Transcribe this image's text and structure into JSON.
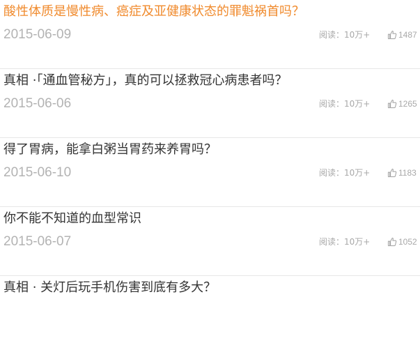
{
  "articles": [
    {
      "title": "酸性体质是慢性病、癌症及亚健康状态的罪魁祸首吗？",
      "date": "2015-06-09",
      "reads": "阅读：10万+",
      "likes": "1487",
      "title_color": "#f08a2c"
    },
    {
      "title": "真相 ·「通血管秘方」，真的可以拯救冠心病患者吗？",
      "date": "2015-06-06",
      "reads": "阅读：10万+",
      "likes": "1265"
    },
    {
      "title": "得了胃病，能拿白粥当胃药来养胃吗？",
      "date": "2015-06-10",
      "reads": "阅读：10万+",
      "likes": "1183"
    },
    {
      "title": "你不能不知道的血型常识",
      "date": "2015-06-07",
      "reads": "阅读：10万+",
      "likes": "1052"
    },
    {
      "title": "真相 · 关灯后玩手机伤害到底有多大？"
    }
  ],
  "icons": {
    "like": "thumbs-up-icon"
  }
}
